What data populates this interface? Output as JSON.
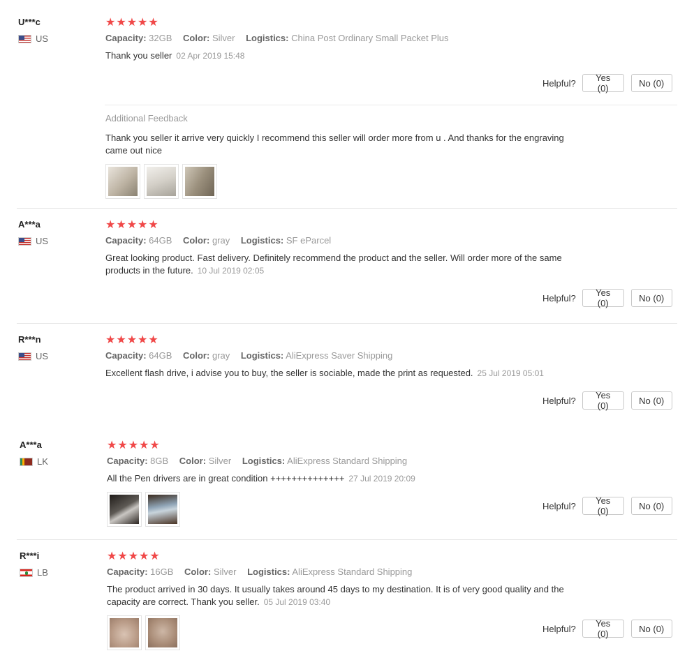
{
  "colors": {
    "star": "#f04848",
    "divider": "#e6e6e6",
    "muted": "#999999"
  },
  "labels": {
    "helpful": "Helpful?",
    "capacity": "Capacity:",
    "color": "Color:",
    "logistics": "Logistics:",
    "additional_feedback": "Additional Feedback"
  },
  "reviews": [
    {
      "user": "U***c",
      "country": "US",
      "stars": "★★★★★",
      "capacity": "32GB",
      "color": "Silver",
      "logistics": "China Post Ordinary Small Packet Plus",
      "text": "Thank you seller",
      "date": "02 Apr 2019 15:48",
      "yes": "Yes (0)",
      "no": "No (0)",
      "additional_text": "Thank you seller it arrive very quickly I recommend this seller will order more from u . And thanks for the engraving came out nice"
    },
    {
      "user": "A***a",
      "country": "US",
      "stars": "★★★★★",
      "capacity": "64GB",
      "color": "gray",
      "logistics": "SF eParcel",
      "text": "Great looking product. Fast delivery. Definitely recommend the product and the seller. Will order more of the same products in the future.",
      "date": "10 Jul 2019 02:05",
      "yes": "Yes (0)",
      "no": "No (0)"
    },
    {
      "user": "R***n",
      "country": "US",
      "stars": "★★★★★",
      "capacity": "64GB",
      "color": "gray",
      "logistics": "AliExpress Saver Shipping",
      "text": "Excellent flash drive, i advise you to buy, the seller is sociable, made the print as requested.",
      "date": "25 Jul 2019 05:01",
      "yes": "Yes (0)",
      "no": "No (0)"
    },
    {
      "user": "A***a",
      "country": "LK",
      "stars": "★★★★★",
      "capacity": "8GB",
      "color": "Silver",
      "logistics": "AliExpress Standard Shipping",
      "text": "All the Pen drivers are in great condition ++++++++++++++",
      "date": "27 Jul 2019 20:09",
      "yes": "Yes (0)",
      "no": "No (0)"
    },
    {
      "user": "R***i",
      "country": "LB",
      "stars": "★★★★★",
      "capacity": "16GB",
      "color": "Silver",
      "logistics": "AliExpress Standard Shipping",
      "text": "The product arrived in 30 days. It usually takes around 45 days to my destination. It is of very good quality and the capacity are correct. Thank you seller.",
      "date": "05 Jul 2019 03:40",
      "yes": "Yes (0)",
      "no": "No (0)"
    }
  ]
}
